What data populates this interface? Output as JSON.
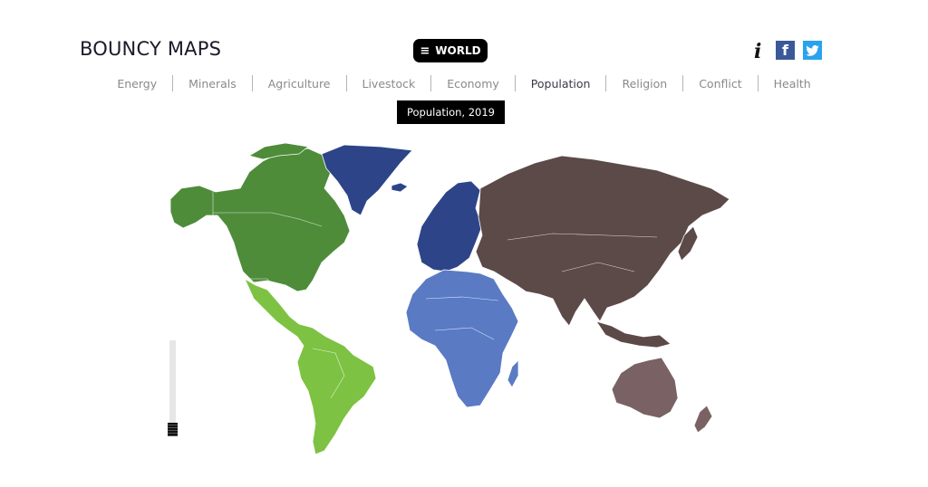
{
  "header": {
    "brand": "BOUNCY MAPS",
    "world_button": {
      "icon": "hamburger-icon",
      "label": "WORLD"
    },
    "info_icon": "i",
    "social": [
      {
        "name": "facebook",
        "glyph": "f",
        "color": "#3b5998"
      },
      {
        "name": "twitter",
        "color": "#2aa3ef"
      }
    ]
  },
  "nav": {
    "items": [
      {
        "label": "Energy",
        "active": false
      },
      {
        "label": "Minerals",
        "active": false
      },
      {
        "label": "Agriculture",
        "active": false
      },
      {
        "label": "Livestock",
        "active": false
      },
      {
        "label": "Economy",
        "active": false
      },
      {
        "label": "Population",
        "active": true
      },
      {
        "label": "Religion",
        "active": false
      },
      {
        "label": "Conflict",
        "active": false
      },
      {
        "label": "Health",
        "active": false
      }
    ]
  },
  "tooltip": {
    "label": "Population, 2019"
  },
  "map": {
    "regions": [
      {
        "name": "North America",
        "color": "#4e8c3a"
      },
      {
        "name": "Latin America",
        "color": "#7dc242"
      },
      {
        "name": "Europe",
        "color": "#2d4488"
      },
      {
        "name": "Africa",
        "color": "#5a7ac4"
      },
      {
        "name": "Asia",
        "color": "#5c4a48"
      },
      {
        "name": "Oceania",
        "color": "#7a6264"
      }
    ]
  },
  "slider": {
    "value": 0
  }
}
